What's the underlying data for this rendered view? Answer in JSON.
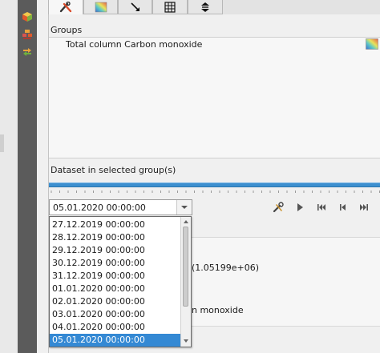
{
  "toolbar_icons": [
    "cube-icon",
    "layers-icon",
    "arrows-icon"
  ],
  "tabs": [
    {
      "icon": "wrench-icon"
    },
    {
      "icon": "colormap-icon"
    },
    {
      "icon": "arrow-pointer-icon"
    },
    {
      "icon": "grid-icon"
    },
    {
      "icon": "stack-icon"
    }
  ],
  "groups": {
    "title": "Groups",
    "items": [
      {
        "label": "Total column Carbon monoxide",
        "icon": "colormap-icon"
      }
    ]
  },
  "dataset": {
    "title": "Dataset in selected group(s)"
  },
  "time_combo": {
    "selected": "05.01.2020 00:00:00",
    "options": [
      "27.12.2019 00:00:00",
      "28.12.2019 00:00:00",
      "29.12.2019 00:00:00",
      "30.12.2019 00:00:00",
      "31.12.2019 00:00:00",
      "01.01.2020 00:00:00",
      "02.01.2020 00:00:00",
      "03.01.2020 00:00:00",
      "04.01.2020 00:00:00",
      "05.01.2020 00:00:00"
    ]
  },
  "playback": [
    "settings-wrench-icon",
    "play-icon",
    "skip-first-icon",
    "step-back-icon",
    "skip-last-icon"
  ],
  "info": {
    "value_fragment": "(1.05199e+06)",
    "name_fragment": "n monoxide"
  },
  "colors": {
    "accent": "#3489d4",
    "toolbar": "#5b5b5b"
  }
}
